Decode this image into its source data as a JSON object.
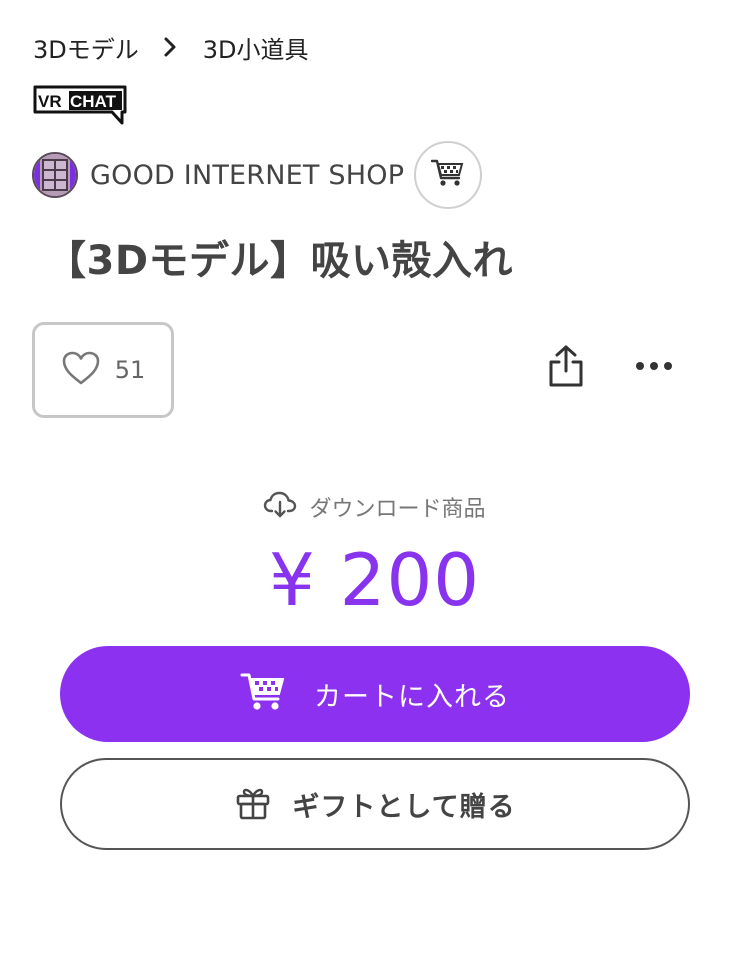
{
  "breadcrumb": {
    "items": [
      "3Dモデル",
      "3D小道具"
    ]
  },
  "badge": {
    "platform": "VRCHAT"
  },
  "shop": {
    "name": "GOOD INTERNET SHOP"
  },
  "product": {
    "title": "【3Dモデル】吸い殻入れ",
    "likes": "51",
    "type_label": "ダウンロード商品",
    "price": "¥ 200"
  },
  "actions": {
    "add_to_cart": "カートに入れる",
    "gift": "ギフトとして贈る"
  },
  "colors": {
    "accent": "#8d31f0",
    "price_text": "#8833ee"
  },
  "icons": [
    "chevron-right-icon",
    "shop-cart-icon",
    "heart-icon",
    "share-icon",
    "more-icon",
    "cloud-download-icon",
    "cart-icon",
    "gift-icon"
  ]
}
